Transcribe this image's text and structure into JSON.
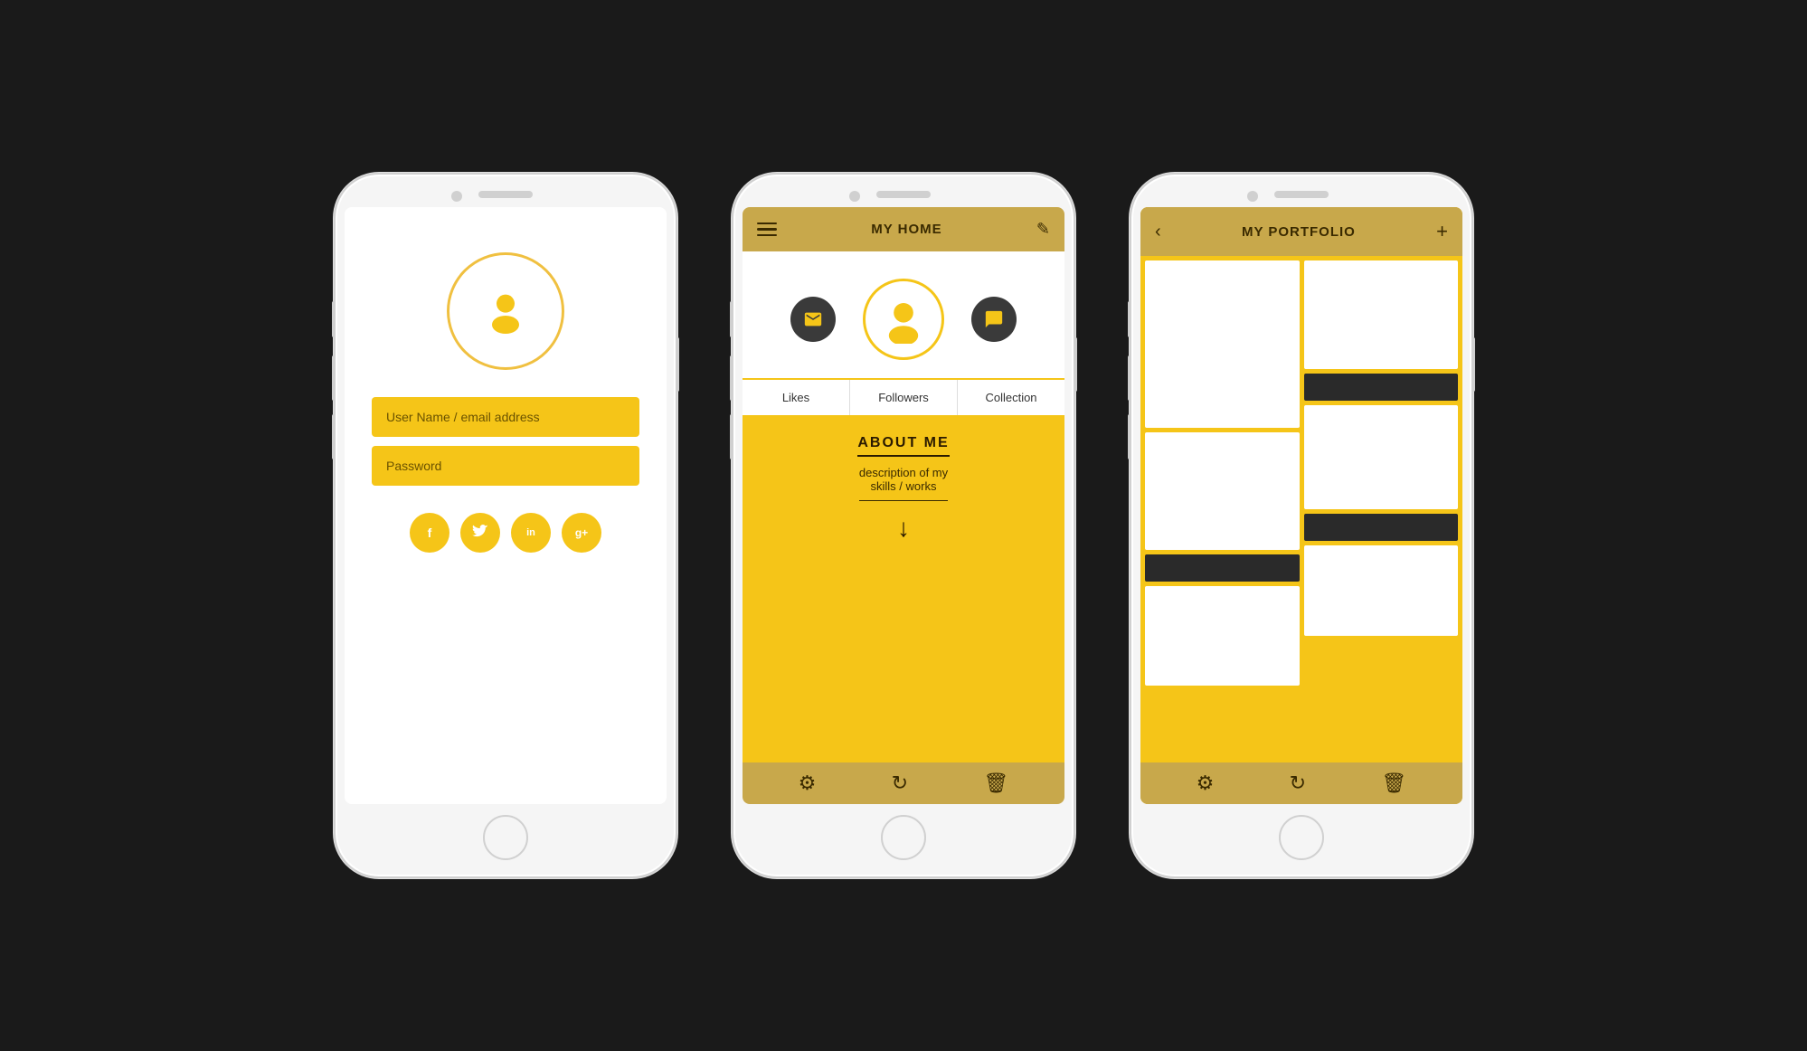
{
  "screen1": {
    "username_placeholder": "User Name / email address",
    "password_placeholder": "Password",
    "social": [
      {
        "label": "f",
        "name": "facebook"
      },
      {
        "label": "t",
        "name": "twitter"
      },
      {
        "label": "in",
        "name": "linkedin"
      },
      {
        "label": "g+",
        "name": "googleplus"
      }
    ]
  },
  "screen2": {
    "header_title": "MY HOME",
    "tabs": [
      "Likes",
      "Followers",
      "Collection"
    ],
    "about_title": "ABOUT ME",
    "about_desc": "description of my\nskills / works",
    "bottom_icons": [
      "gear",
      "refresh",
      "trash"
    ]
  },
  "screen3": {
    "header_title": "MY PORTFOLIO",
    "bottom_icons": [
      "gear",
      "refresh",
      "trash"
    ]
  },
  "colors": {
    "gold": "#f5c518",
    "dark_gold": "#c8a84b",
    "dark": "#2a2a2a",
    "text_dark": "#3a2a00"
  }
}
